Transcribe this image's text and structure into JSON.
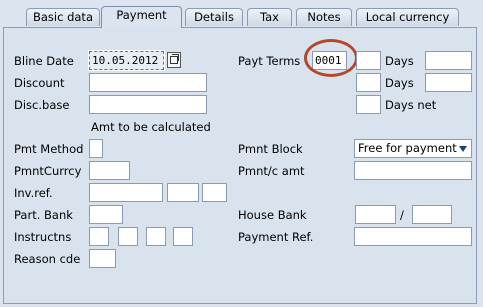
{
  "tabs": [
    {
      "label": "Basic data"
    },
    {
      "label": "Payment",
      "active": true
    },
    {
      "label": "Details"
    },
    {
      "label": "Tax"
    },
    {
      "label": "Notes"
    },
    {
      "label": "Local currency"
    }
  ],
  "left": {
    "bline_date": {
      "label": "Bline Date",
      "value": "10.05.2012"
    },
    "discount": {
      "label": "Discount",
      "value": ""
    },
    "disc_base": {
      "label": "Disc.base",
      "value": ""
    },
    "amt_note": "Amt to be calculated",
    "pmt_method": {
      "label": "Pmt Method",
      "value": ""
    },
    "pmnt_currcy": {
      "label": "PmntCurrcy",
      "value": ""
    },
    "inv_ref": {
      "label": "Inv.ref.",
      "value": ""
    },
    "part_bank": {
      "label": "Part. Bank",
      "value": ""
    },
    "instructns": {
      "label": "Instructns",
      "value": ""
    },
    "reason_cde": {
      "label": "Reason cde",
      "value": ""
    }
  },
  "right": {
    "payt_terms": {
      "label": "Payt Terms",
      "value": "0001"
    },
    "days1": "Days",
    "days2": "Days",
    "days_net": "Days net",
    "pmnt_block": {
      "label": "Pmnt Block",
      "value": "Free for payment"
    },
    "pmnt_amt": {
      "label": "Pmnt/c amt",
      "value": ""
    },
    "house_bank": {
      "label": "House Bank",
      "separator": "/"
    },
    "payment_ref": {
      "label": "Payment Ref.",
      "value": ""
    }
  },
  "colors": {
    "panel": "#d9e3ee",
    "highlight": "#b5472a",
    "border": "#8a9bb3"
  }
}
